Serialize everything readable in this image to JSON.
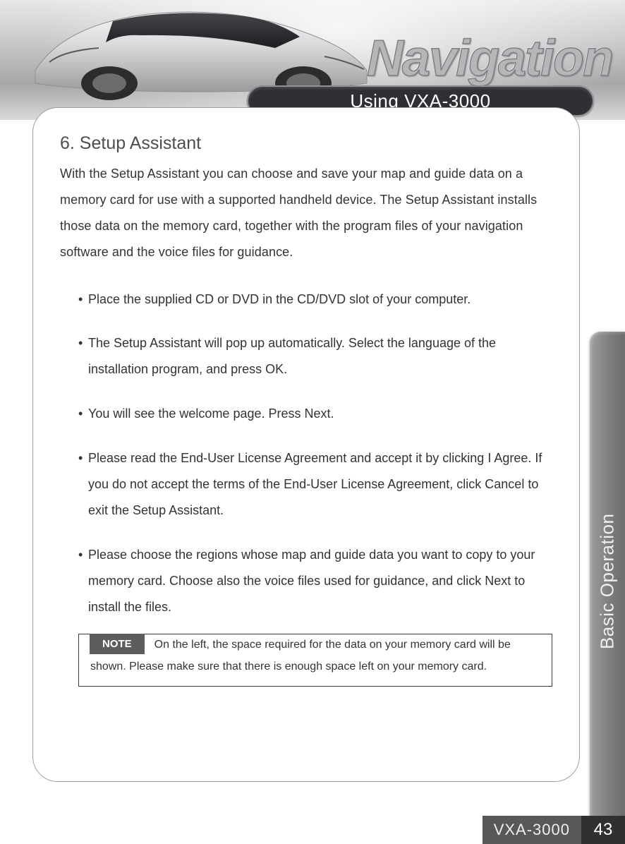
{
  "hero": {
    "navigation_word": "Navigation"
  },
  "chapter": {
    "title": "Using VXA-3000"
  },
  "sidebar": {
    "label": "Basic Operation"
  },
  "content": {
    "heading": "6. Setup Assistant",
    "intro": "With the Setup Assistant you can choose and save your map and guide data on a memory card for use with a supported handheld device. The Setup Assistant installs those data on the memory card, together with the program files of your navigation software and the voice files for guidance.",
    "bullets": [
      "Place the supplied CD or DVD in the CD/DVD slot of your computer.",
      "The Setup Assistant will pop up automatically. Select the language of the installation program, and press OK.",
      "You will see the welcome page. Press Next.",
      "Please read the End-User License Agreement and accept it by clicking I Agree. If you do not accept the terms of the End-User License Agreement, click Cancel to exit the Setup Assistant.",
      "Please choose the regions whose map and guide data you want to copy to your memory card. Choose also the voice files used for guidance, and click Next to install the files."
    ],
    "note": {
      "badge": "NOTE",
      "text": "On the left, the space required for the data on your memory card will be shown. Please make sure that there is enough space left on your memory card."
    }
  },
  "footer": {
    "model": "VXA-3000",
    "page": "43"
  }
}
